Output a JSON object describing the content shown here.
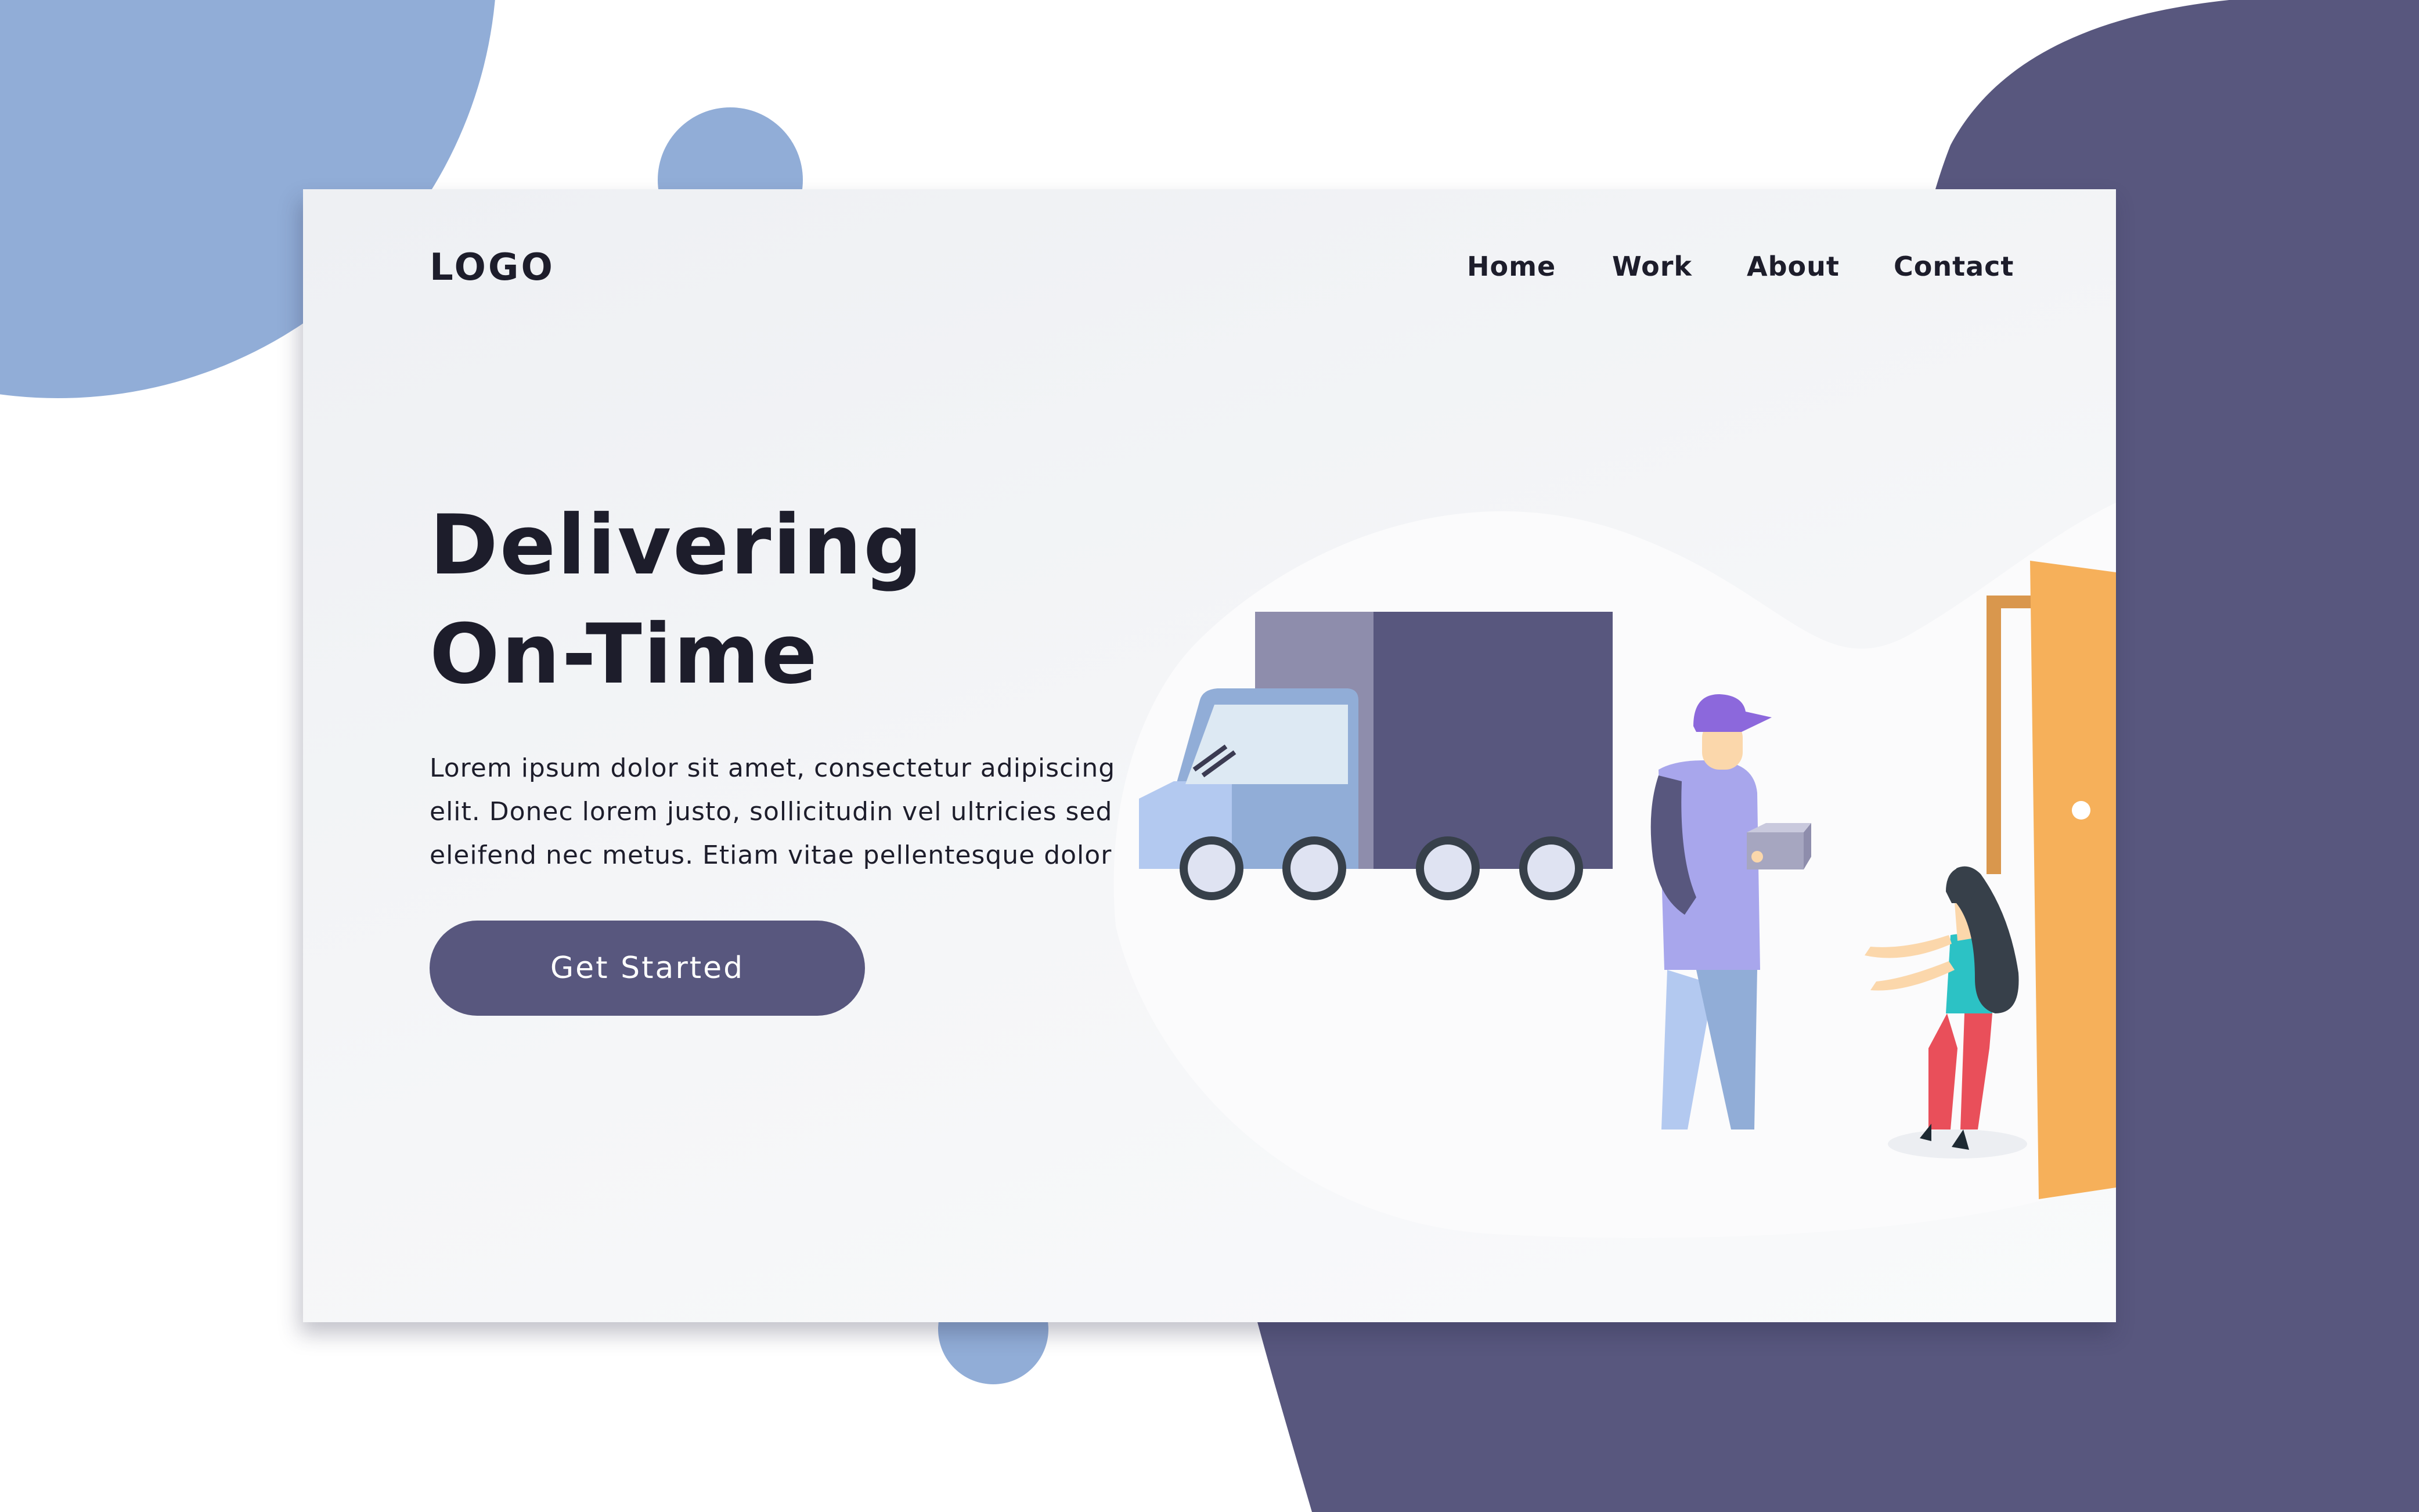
{
  "header": {
    "logo": "LOGO",
    "nav": [
      {
        "label": "Home"
      },
      {
        "label": "Work"
      },
      {
        "label": "About"
      },
      {
        "label": "Contact"
      }
    ]
  },
  "hero": {
    "title_lines": [
      "Delivering",
      "On-Time"
    ],
    "body_lines": [
      "Lorem ipsum dolor sit amet, consectetur  adipiscing",
      "elit. Donec lorem justo, sollicitudin vel ultricies sed",
      "eleifend nec metus. Etiam vitae pellentesque dolor"
    ],
    "cta_label": "Get Started"
  },
  "colors": {
    "accent": "#58577e",
    "light_blue": "#91add7",
    "truck_cab": "#a9bff0",
    "door": "#f6b05a"
  },
  "illustration": {
    "icons": [
      "delivery-truck-icon",
      "courier-person-icon",
      "parcel-box-icon",
      "customer-woman-icon",
      "open-door-icon"
    ]
  }
}
